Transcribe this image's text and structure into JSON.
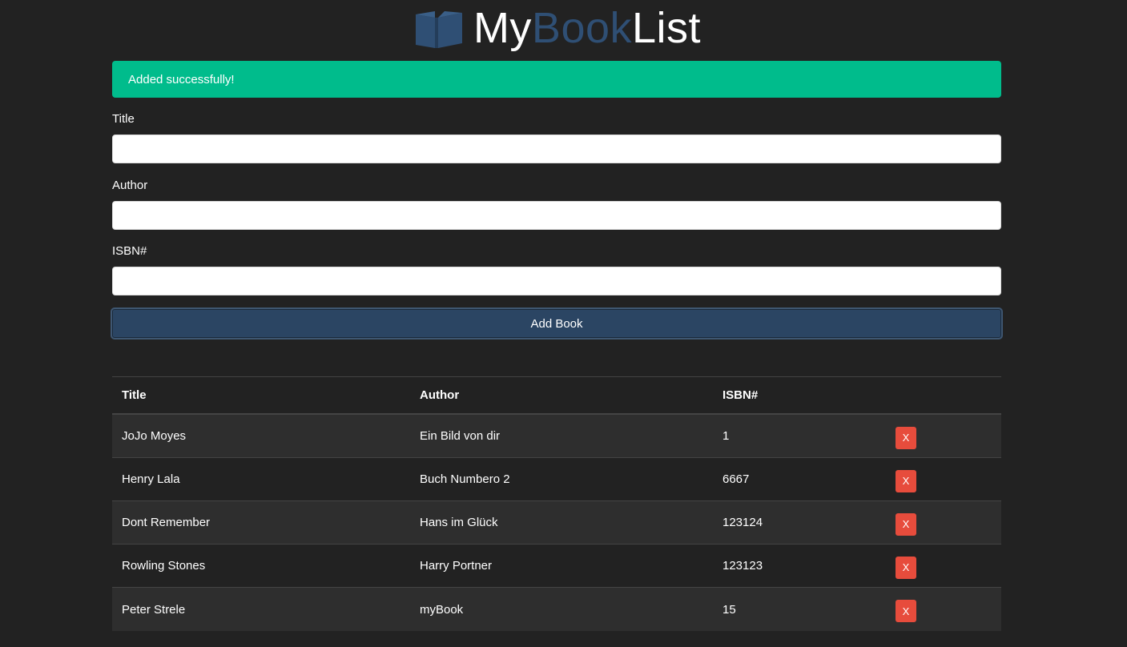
{
  "header": {
    "logo_icon": "open-book-icon",
    "title_part1": "My",
    "title_part2": "Book",
    "title_part3": "List",
    "accent_color": "#2f4f74"
  },
  "alert": {
    "message": "Added successfully!",
    "color": "#00bc8c"
  },
  "form": {
    "title_label": "Title",
    "title_value": "",
    "author_label": "Author",
    "author_value": "",
    "isbn_label": "ISBN#",
    "isbn_value": "",
    "submit_label": "Add Book"
  },
  "table": {
    "headers": [
      "Title",
      "Author",
      "ISBN#",
      ""
    ],
    "rows": [
      {
        "title": "JoJo Moyes",
        "author": "Ein Bild von dir",
        "isbn": "1",
        "delete_label": "X"
      },
      {
        "title": "Henry Lala",
        "author": "Buch Numbero 2",
        "isbn": "6667",
        "delete_label": "X"
      },
      {
        "title": "Dont Remember",
        "author": "Hans im Glück",
        "isbn": "123124",
        "delete_label": "X"
      },
      {
        "title": "Rowling Stones",
        "author": "Harry Portner",
        "isbn": "123123",
        "delete_label": "X"
      },
      {
        "title": "Peter Strele",
        "author": "myBook",
        "isbn": "15",
        "delete_label": "X"
      }
    ],
    "delete_color": "#e74c3c"
  }
}
